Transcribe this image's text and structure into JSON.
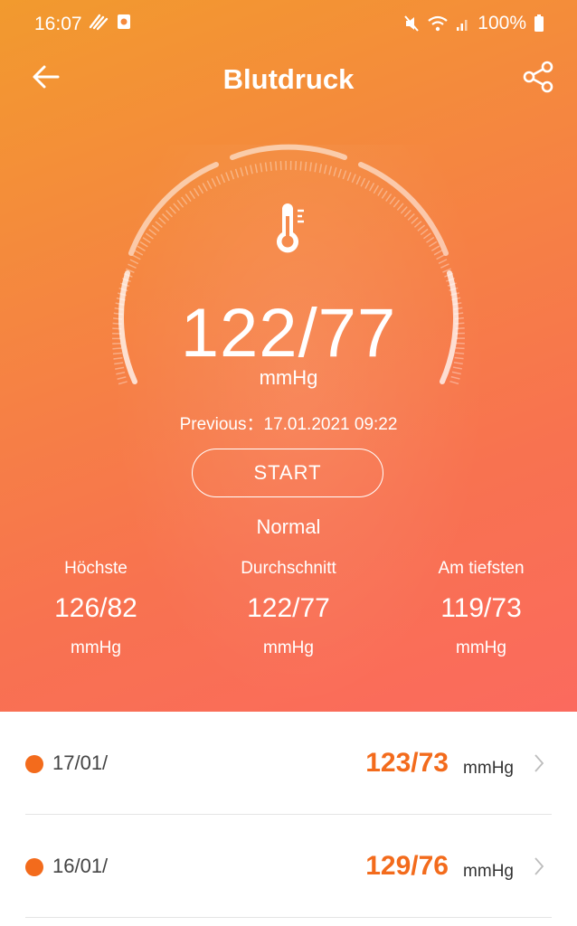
{
  "status_bar": {
    "time": "16:07",
    "battery": "100%"
  },
  "app_bar": {
    "title": "Blutdruck"
  },
  "measurement": {
    "value": "122/77",
    "unit": "mmHg",
    "previous": "Previous：17.01.2021 09:22",
    "start_label": "START",
    "status": "Normal"
  },
  "stats": [
    {
      "label": "Höchste",
      "value": "126/82",
      "unit": "mmHg"
    },
    {
      "label": "Durchschnitt",
      "value": "122/77",
      "unit": "mmHg"
    },
    {
      "label": "Am tiefsten",
      "value": "119/73",
      "unit": "mmHg"
    }
  ],
  "history": [
    {
      "date": "17/01/",
      "value": "123/73",
      "unit": "mmHg"
    },
    {
      "date": "16/01/",
      "value": "129/76",
      "unit": "mmHg"
    }
  ],
  "colors": {
    "accent": "#f36b1c",
    "gradient_top": "#f29a2e",
    "gradient_bottom": "#fb6a5e"
  }
}
